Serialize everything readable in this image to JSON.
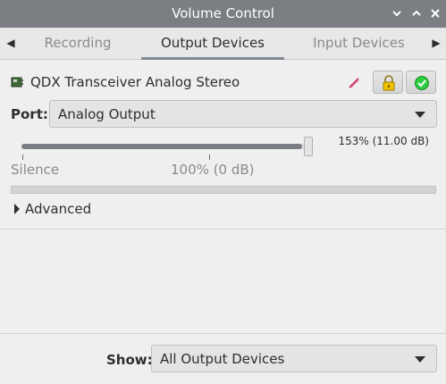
{
  "window": {
    "title": "Volume Control",
    "controls": [
      "minimize-icon",
      "maximize-icon",
      "close-icon"
    ]
  },
  "tabs": {
    "items": [
      {
        "label": "Recording",
        "active": false
      },
      {
        "label": "Output Devices",
        "active": true
      },
      {
        "label": "Input Devices",
        "active": false
      }
    ]
  },
  "device": {
    "name": "QDX Transceiver Analog Stereo",
    "port_label": "Port:",
    "port_value": "Analog Output",
    "volume_readout": "153% (11.00 dB)",
    "volume_fraction": 0.98,
    "scale_silence": "Silence",
    "scale_100": "100% (0 dB)",
    "advanced_label": "Advanced",
    "icons": [
      "sound-card-icon",
      "mute-icon",
      "lock-icon",
      "default-check-icon"
    ]
  },
  "footer": {
    "show_label": "Show:",
    "show_value": "All Output Devices"
  },
  "colors": {
    "titlebar": "#7b7e82",
    "slider_fill": "#7a7d82",
    "check_green": "#2ecc40",
    "lock_yellow": "#f2c200"
  }
}
